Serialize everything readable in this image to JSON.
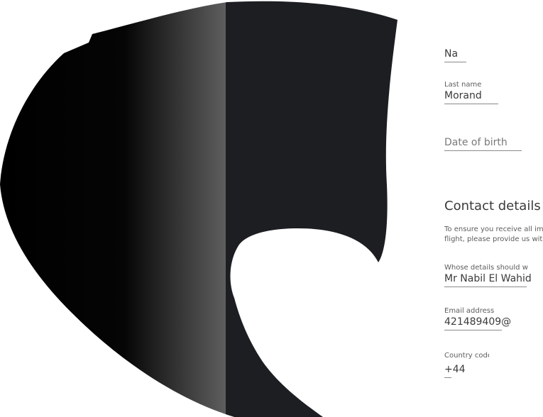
{
  "art": {
    "colors": {
      "dark": "#1c1e22",
      "black": "#000000",
      "gradient_light": "#5e5e5e"
    }
  },
  "form": {
    "first_name": {
      "value": "Na"
    },
    "last_name": {
      "label": "Last name",
      "value": "Morand"
    },
    "date_of_birth": {
      "placeholder": "Date of birth"
    },
    "contact": {
      "heading": "Contact details",
      "note_line1": "To ensure you receive all im",
      "note_line2": "flight, please provide us with",
      "whose_details": {
        "label": "Whose details should we use",
        "value": "Mr Nabil El Wahidi"
      },
      "email": {
        "label": "Email address",
        "value": "421489409@"
      },
      "country_code": {
        "label": "Country code",
        "value": "+44"
      }
    }
  }
}
